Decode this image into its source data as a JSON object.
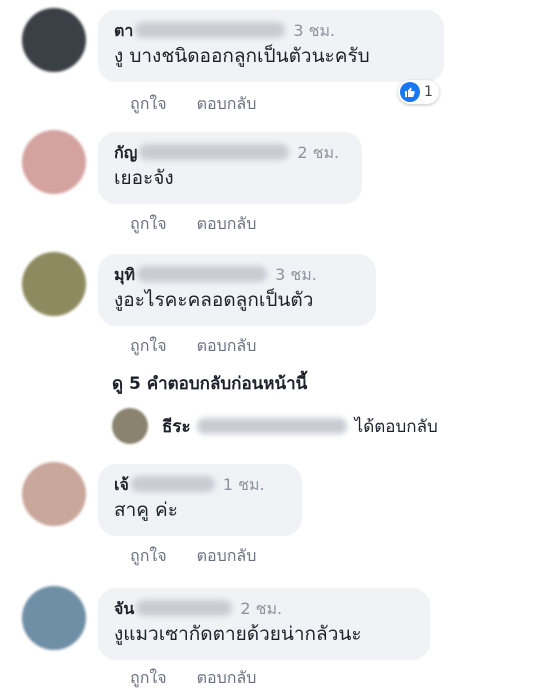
{
  "comments": [
    {
      "name": "ตา",
      "time": "3 ชม.",
      "text": "งู บางชนิดออกลูกเป็นตัวนะครับ",
      "like": "ถูกใจ",
      "reply": "ตอบกลับ",
      "reaction_count": "1",
      "avatar_color": "#3b3f46"
    },
    {
      "name": "กัญ",
      "time": "2 ชม.",
      "text": "เยอะจัง",
      "like": "ถูกใจ",
      "reply": "ตอบกลับ",
      "avatar_color": "#d4a3a0"
    },
    {
      "name": "มุทิ",
      "time": "3 ชม.",
      "text": "งูอะไรคะคลอดลูกเป็นตัว",
      "like": "ถูกใจ",
      "reply": "ตอบกลับ",
      "avatar_color": "#8d8a5f"
    },
    {
      "name": "เจ้",
      "time": "1 ชม.",
      "text": "สาคู ค่ะ",
      "like": "ถูกใจ",
      "reply": "ตอบกลับ",
      "avatar_color": "#c9a79a"
    },
    {
      "name": "จัน",
      "time": "2 ชม.",
      "text": "งูแมวเซากัดตายด้วยน่ากลัวนะ",
      "like": "ถูกใจ",
      "reply": "ตอบกลับ",
      "avatar_color": "#6f8fa6"
    }
  ],
  "more_replies": "ดู 5 คำตอบกลับก่อนหน้านี้",
  "reply_summary": {
    "name": "ธีระ",
    "text": "ได้ตอบกลับ"
  },
  "accent_color": "#1877f2"
}
